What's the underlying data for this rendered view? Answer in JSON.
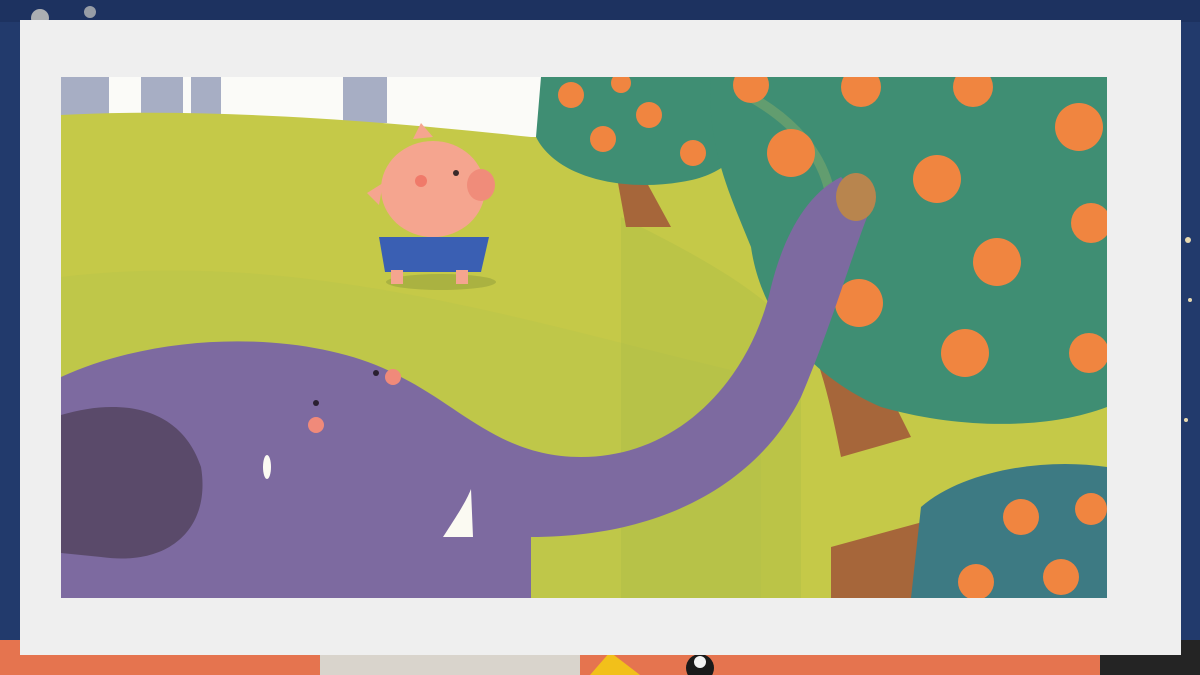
{
  "slide": {
    "background": {
      "colors": {
        "navy": "#1f3566",
        "deep_blue": "#2a4478",
        "coral": "#f07a5a",
        "paper": "#efefef"
      }
    },
    "illustration": {
      "scene": [
        {
          "subject": "pig",
          "colors": {
            "skin": "#f5a58f",
            "overalls": "#3a5fb3"
          }
        },
        {
          "subject": "elephant",
          "colors": {
            "body": "#7d6aa0",
            "ear": "#5a4a6a",
            "tusk": "#fbfaf2"
          }
        },
        {
          "subject": "apple-tree",
          "count": 3,
          "colors": {
            "foliage": "#3f8e73",
            "apple": "#f08540",
            "trunk": "#a6663a"
          }
        }
      ],
      "colors": {
        "grass": "#c8cc4a",
        "sky": "#fbfbf8"
      }
    }
  }
}
